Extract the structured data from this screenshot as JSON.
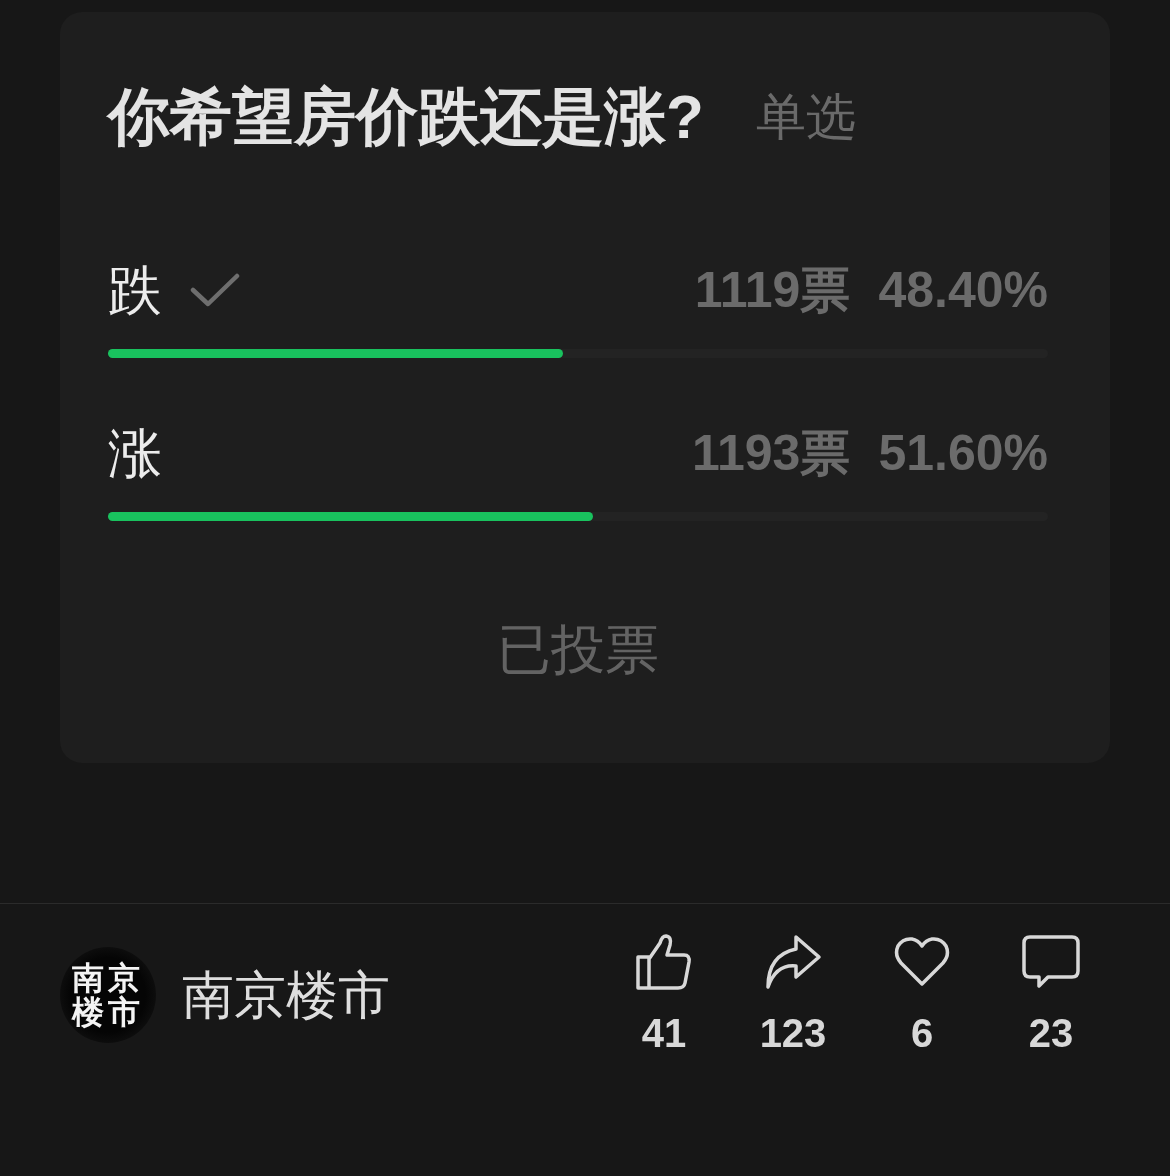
{
  "poll": {
    "question": "你希望房价跌还是涨?",
    "mode": "单选",
    "options": [
      {
        "label": "跌",
        "selected": true,
        "votes": "1119票",
        "percent": "48.40%",
        "level": 0.484
      },
      {
        "label": "涨",
        "selected": false,
        "votes": "1193票",
        "percent": "51.60%",
        "level": 0.516
      }
    ],
    "vote_button": {
      "label": "已投票",
      "disabled": true
    }
  },
  "author": {
    "avatar_lines": [
      "南京",
      "楼市"
    ],
    "name": "南京楼市"
  },
  "actions": [
    {
      "kind": "like",
      "count": "41"
    },
    {
      "kind": "share",
      "count": "123"
    },
    {
      "kind": "favorite",
      "count": "6"
    },
    {
      "kind": "comment",
      "count": "23"
    }
  ]
}
